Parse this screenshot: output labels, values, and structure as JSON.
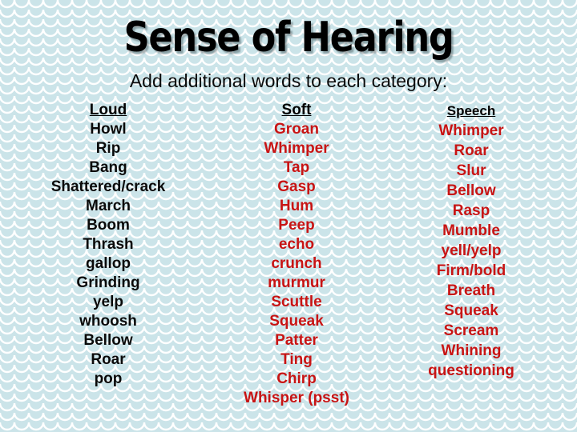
{
  "slide": {
    "title": "Sense of Hearing",
    "subtitle": "Add additional words to each category:",
    "background_color": "#cbe4e9",
    "pattern_color": "#ffffff",
    "title_color": "#000000",
    "accent_color": "#c81414"
  },
  "columns": [
    {
      "header": "Loud",
      "text_color": "#0a0a0a",
      "words": [
        "Howl",
        "Rip",
        "Bang",
        "Shattered/crack",
        "March",
        "Boom",
        "Thrash",
        "gallop",
        "Grinding",
        "yelp",
        "whoosh",
        "Bellow",
        "Roar",
        "pop"
      ]
    },
    {
      "header": "Soft",
      "text_color": "#c81414",
      "words": [
        "Groan",
        "Whimper",
        "Tap",
        "Gasp",
        "Hum",
        "Peep",
        "echo",
        "crunch",
        "murmur",
        "Scuttle",
        "Squeak",
        "Patter",
        "Ting",
        "Chirp",
        "Whisper (psst)"
      ]
    },
    {
      "header": "Speech",
      "text_color": "#c81414",
      "words": [
        "Whimper",
        "Roar",
        "Slur",
        "Bellow",
        "Rasp",
        "Mumble",
        "yell/yelp",
        "Firm/bold",
        "Breath",
        "Squeak",
        "Scream",
        "Whining",
        "questioning"
      ]
    }
  ]
}
